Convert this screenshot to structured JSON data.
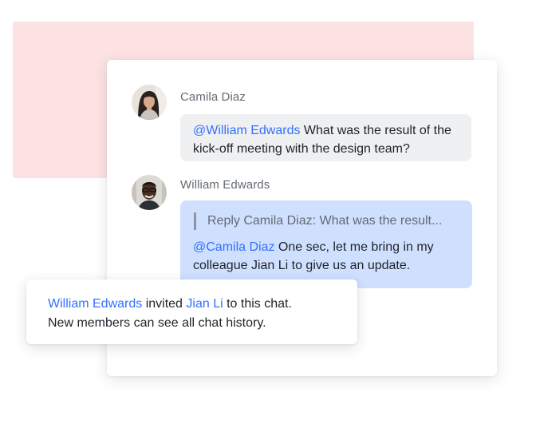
{
  "messages": [
    {
      "sender": "Camila Diaz",
      "mention": "@William Edwards",
      "text": " What was the result of the kick-off meeting with the design team?"
    },
    {
      "sender": "William Edwards",
      "quote": "Reply Camila Diaz: What was the result...",
      "mention": "@Camila Diaz",
      "text": " One sec, let me bring in my colleague Jian Li to give us an update."
    }
  ],
  "system_notice": {
    "inviter": "William Edwards",
    "action": " invited ",
    "invitee": "Jian Li",
    "suffix": " to this chat.",
    "line2": "New members can see all chat history."
  },
  "colors": {
    "mention": "#3370ff",
    "background_accent": "#fde2e4",
    "bubble_grey": "#eff0f1",
    "bubble_blue": "#cfe0ff"
  }
}
